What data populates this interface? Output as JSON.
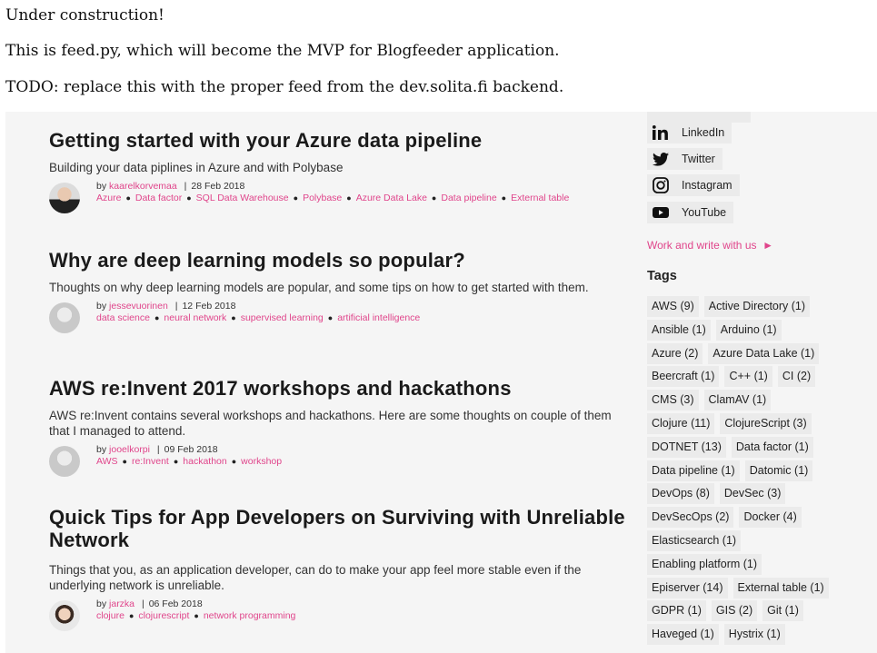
{
  "notes": {
    "line1": "Under construction!",
    "line2": "This is feed.py, which will become the MVP for Blogfeeder application.",
    "line3": "TODO: replace this with the proper feed from the dev.solita.fi backend."
  },
  "posts": [
    {
      "title": "Getting started with your Azure data pipeline",
      "subtitle": "Building your data piplines in Azure and with Polybase",
      "by": "by ",
      "author": "kaarelkorvemaa",
      "sep": "|",
      "date": "28 Feb 2018",
      "tags": [
        "Azure",
        "Data factor",
        "SQL Data Warehouse",
        "Polybase",
        "Azure Data Lake",
        "Data pipeline",
        "External table"
      ]
    },
    {
      "title": "Why are deep learning models so popular?",
      "subtitle": "Thoughts on why deep learning models are popular, and some tips on how to get started with them.",
      "by": "by ",
      "author": "jessevuorinen",
      "sep": "|",
      "date": "12 Feb 2018",
      "tags": [
        "data science",
        "neural network",
        "supervised learning",
        "artificial intelligence"
      ]
    },
    {
      "title": "AWS re:Invent 2017 workshops and hackathons",
      "subtitle": "AWS re:Invent contains several workshops and hackathons. Here are some thoughts on couple of them that I managed to attend.",
      "by": "by ",
      "author": "jooelkorpi",
      "sep": "|",
      "date": "09 Feb 2018",
      "tags": [
        "AWS",
        "re:Invent",
        "hackathon",
        "workshop"
      ]
    },
    {
      "title": "Quick Tips for App Developers on Surviving with Unreliable Network",
      "subtitle": "Things that you, as an application developer, can do to make your app feel more stable even if the underlying network is unreliable.",
      "by": "by ",
      "author": "jarzka",
      "sep": "|",
      "date": "06 Feb 2018",
      "tags": [
        "clojure",
        "clojurescript",
        "network programming"
      ]
    }
  ],
  "social": [
    {
      "label": "LinkedIn",
      "icon": "linkedin-icon"
    },
    {
      "label": "Twitter",
      "icon": "twitter-icon"
    },
    {
      "label": "Instagram",
      "icon": "instagram-icon"
    },
    {
      "label": "YouTube",
      "icon": "youtube-icon"
    }
  ],
  "work": {
    "label": "Work and write with us",
    "arrow": "►"
  },
  "tags_title": "Tags",
  "tag_rows": [
    [
      "AWS (9)",
      "Active Directory (1)"
    ],
    [
      "Ansible (1)",
      "Arduino (1)"
    ],
    [
      "Azure (2)",
      "Azure Data Lake (1)"
    ],
    [
      "Beercraft (1)",
      "C++ (1)",
      "CI (2)"
    ],
    [
      "CMS (3)",
      "ClamAV (1)"
    ],
    [
      "Clojure (11)",
      "ClojureScript (3)"
    ],
    [
      "DOTNET (13)",
      "Data factor (1)"
    ],
    [
      "Data pipeline (1)",
      "Datomic (1)"
    ],
    [
      "DevOps (8)",
      "DevSec (3)"
    ],
    [
      "DevSecOps (2)",
      "Docker (4)"
    ],
    [
      "Elasticsearch (1)"
    ],
    [
      "Enabling platform (1)"
    ],
    [
      "Episerver (14)",
      "External table (1)"
    ],
    [
      "GDPR (1)",
      "GIS (2)",
      "Git (1)"
    ],
    [
      "Haveged (1)",
      "Hystrix (1)"
    ]
  ]
}
